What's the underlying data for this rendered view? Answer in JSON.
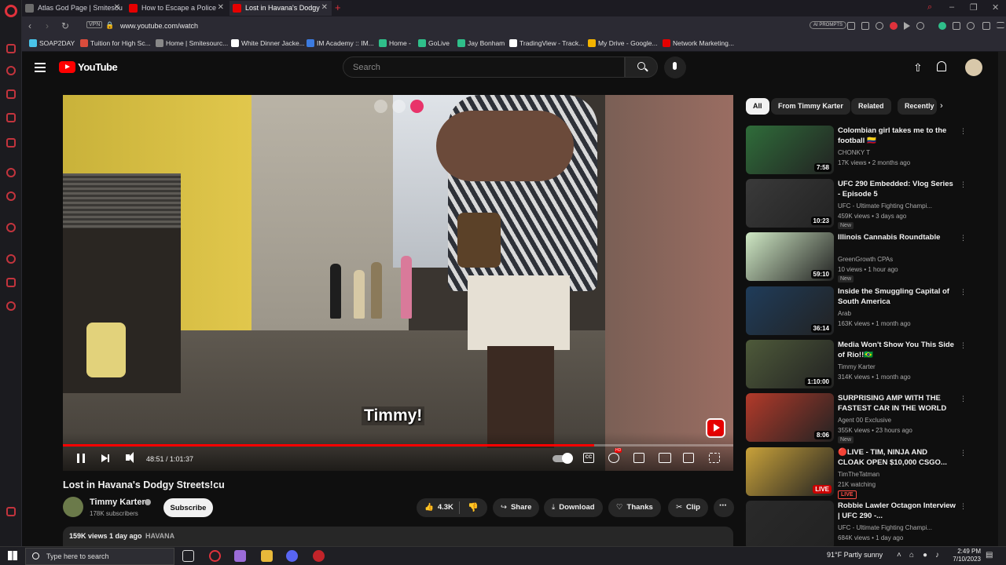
{
  "browser": {
    "tabs": [
      {
        "title": "Atlas God Page | Smitesou",
        "favicon_color": "#6b6b6b"
      },
      {
        "title": "How to Escape a Police",
        "favicon_color": "#e50000"
      },
      {
        "title": "Lost in Havana's Dodgy",
        "favicon_color": "#e50000"
      }
    ],
    "new_tab": "+",
    "vpn_label": "VPN",
    "url": "www.youtube.com/watch",
    "ai_prompts_label": "AI PROMPTS",
    "bookmarks": [
      {
        "label": "SOAP2DAY",
        "color": "#49c3e8"
      },
      {
        "label": "Tuition for High Sc...",
        "color": "#d94c3c"
      },
      {
        "label": "Home | Smitesourc...",
        "color": "#888888"
      },
      {
        "label": "White Dinner Jacke...",
        "color": "#ffffff"
      },
      {
        "label": "IM Academy :: IM...",
        "color": "#3c7be0"
      },
      {
        "label": "Home -",
        "color": "#2fbf8a"
      },
      {
        "label": "GoLive",
        "color": "#2fbf8a"
      },
      {
        "label": "Jay Bonham",
        "color": "#2fbf8a"
      },
      {
        "label": "TradingView - Track...",
        "color": "#ffffff"
      },
      {
        "label": "My Drive - Google...",
        "color": "#f4b400"
      },
      {
        "label": "Network Marketing...",
        "color": "#e50000"
      }
    ]
  },
  "youtube": {
    "logo_text": "YouTube",
    "search_placeholder": "Search",
    "player": {
      "subtitle": "Timmy!",
      "current_time": "48:51",
      "duration": "1:01:37",
      "time_display": "48:51 / 1:01:37",
      "progress_fraction": 0.7927,
      "cc_label": "CC"
    },
    "video": {
      "title": "Lost in Havana's Dodgy Streets!cu",
      "channel": "Timmy Karter",
      "subscribers": "178K subscribers",
      "subscribe_label": "Subscribe",
      "likes": "4.3K",
      "share_label": "Share",
      "download_label": "Download",
      "thanks_label": "Thanks",
      "clip_label": "Clip",
      "views_date": "159K views  1 day ago",
      "tag": "HAVANA"
    },
    "chips": [
      "All",
      "From Timmy Karter",
      "Related",
      "Recently"
    ],
    "recommendations": [
      {
        "title": "Colombian girl takes me to the football 🇨🇴",
        "channel": "CHONKY T",
        "meta": "17K views • 2 months ago",
        "duration": "7:58",
        "badge": "",
        "thumb_bg": "#2f6d3a",
        "verified": false
      },
      {
        "title": "UFC 290 Embedded: Vlog Series - Episode 5",
        "channel": "UFC - Ultimate Fighting Champi...",
        "meta": "459K views • 3 days ago",
        "duration": "10:23",
        "badge": "New",
        "thumb_bg": "#3a3a3a",
        "verified": true
      },
      {
        "title": "Illinois Cannabis Roundtable",
        "channel": "GreenGrowth CPAs",
        "meta": "10 views • 1 hour ago",
        "duration": "59:10",
        "badge": "New",
        "thumb_bg": "#cfe8c4",
        "verified": false
      },
      {
        "title": "Inside the Smuggling Capital of South America",
        "channel": "Arab",
        "meta": "163K views • 1 month ago",
        "duration": "36:14",
        "badge": "",
        "thumb_bg": "#1f3c5a",
        "verified": true
      },
      {
        "title": "Media Won't Show You This Side of Rio!!🇧🇷",
        "channel": "Timmy Karter",
        "meta": "314K views • 1 month ago",
        "duration": "1:10:00",
        "badge": "",
        "thumb_bg": "#4e5a3a",
        "verified": true
      },
      {
        "title": "SURPRISING AMP WITH THE FASTEST CAR IN THE WORLD",
        "channel": "Agent 00 Exclusive",
        "meta": "355K views • 23 hours ago",
        "duration": "8:06",
        "badge": "New",
        "thumb_bg": "#b33a2a",
        "verified": true
      },
      {
        "title": "🔴LIVE - TIM, NINJA AND CLOAK OPEN $10,000 CSGO...",
        "channel": "TimTheTatman",
        "meta": "21K watching",
        "duration": "LIVE",
        "badge": "LIVE",
        "thumb_bg": "#c9a23a",
        "verified": true
      },
      {
        "title": "Robbie Lawler Octagon Interview | UFC 290 -...",
        "channel": "UFC - Ultimate Fighting Champi...",
        "meta": "684K views • 1 day ago",
        "duration": "",
        "badge": "",
        "thumb_bg": "#2a2a2a",
        "verified": true
      }
    ]
  },
  "taskbar": {
    "search_placeholder": "Type here to search",
    "weather": "91°F  Partly sunny",
    "time": "2:49 PM",
    "date": "7/10/2023"
  }
}
